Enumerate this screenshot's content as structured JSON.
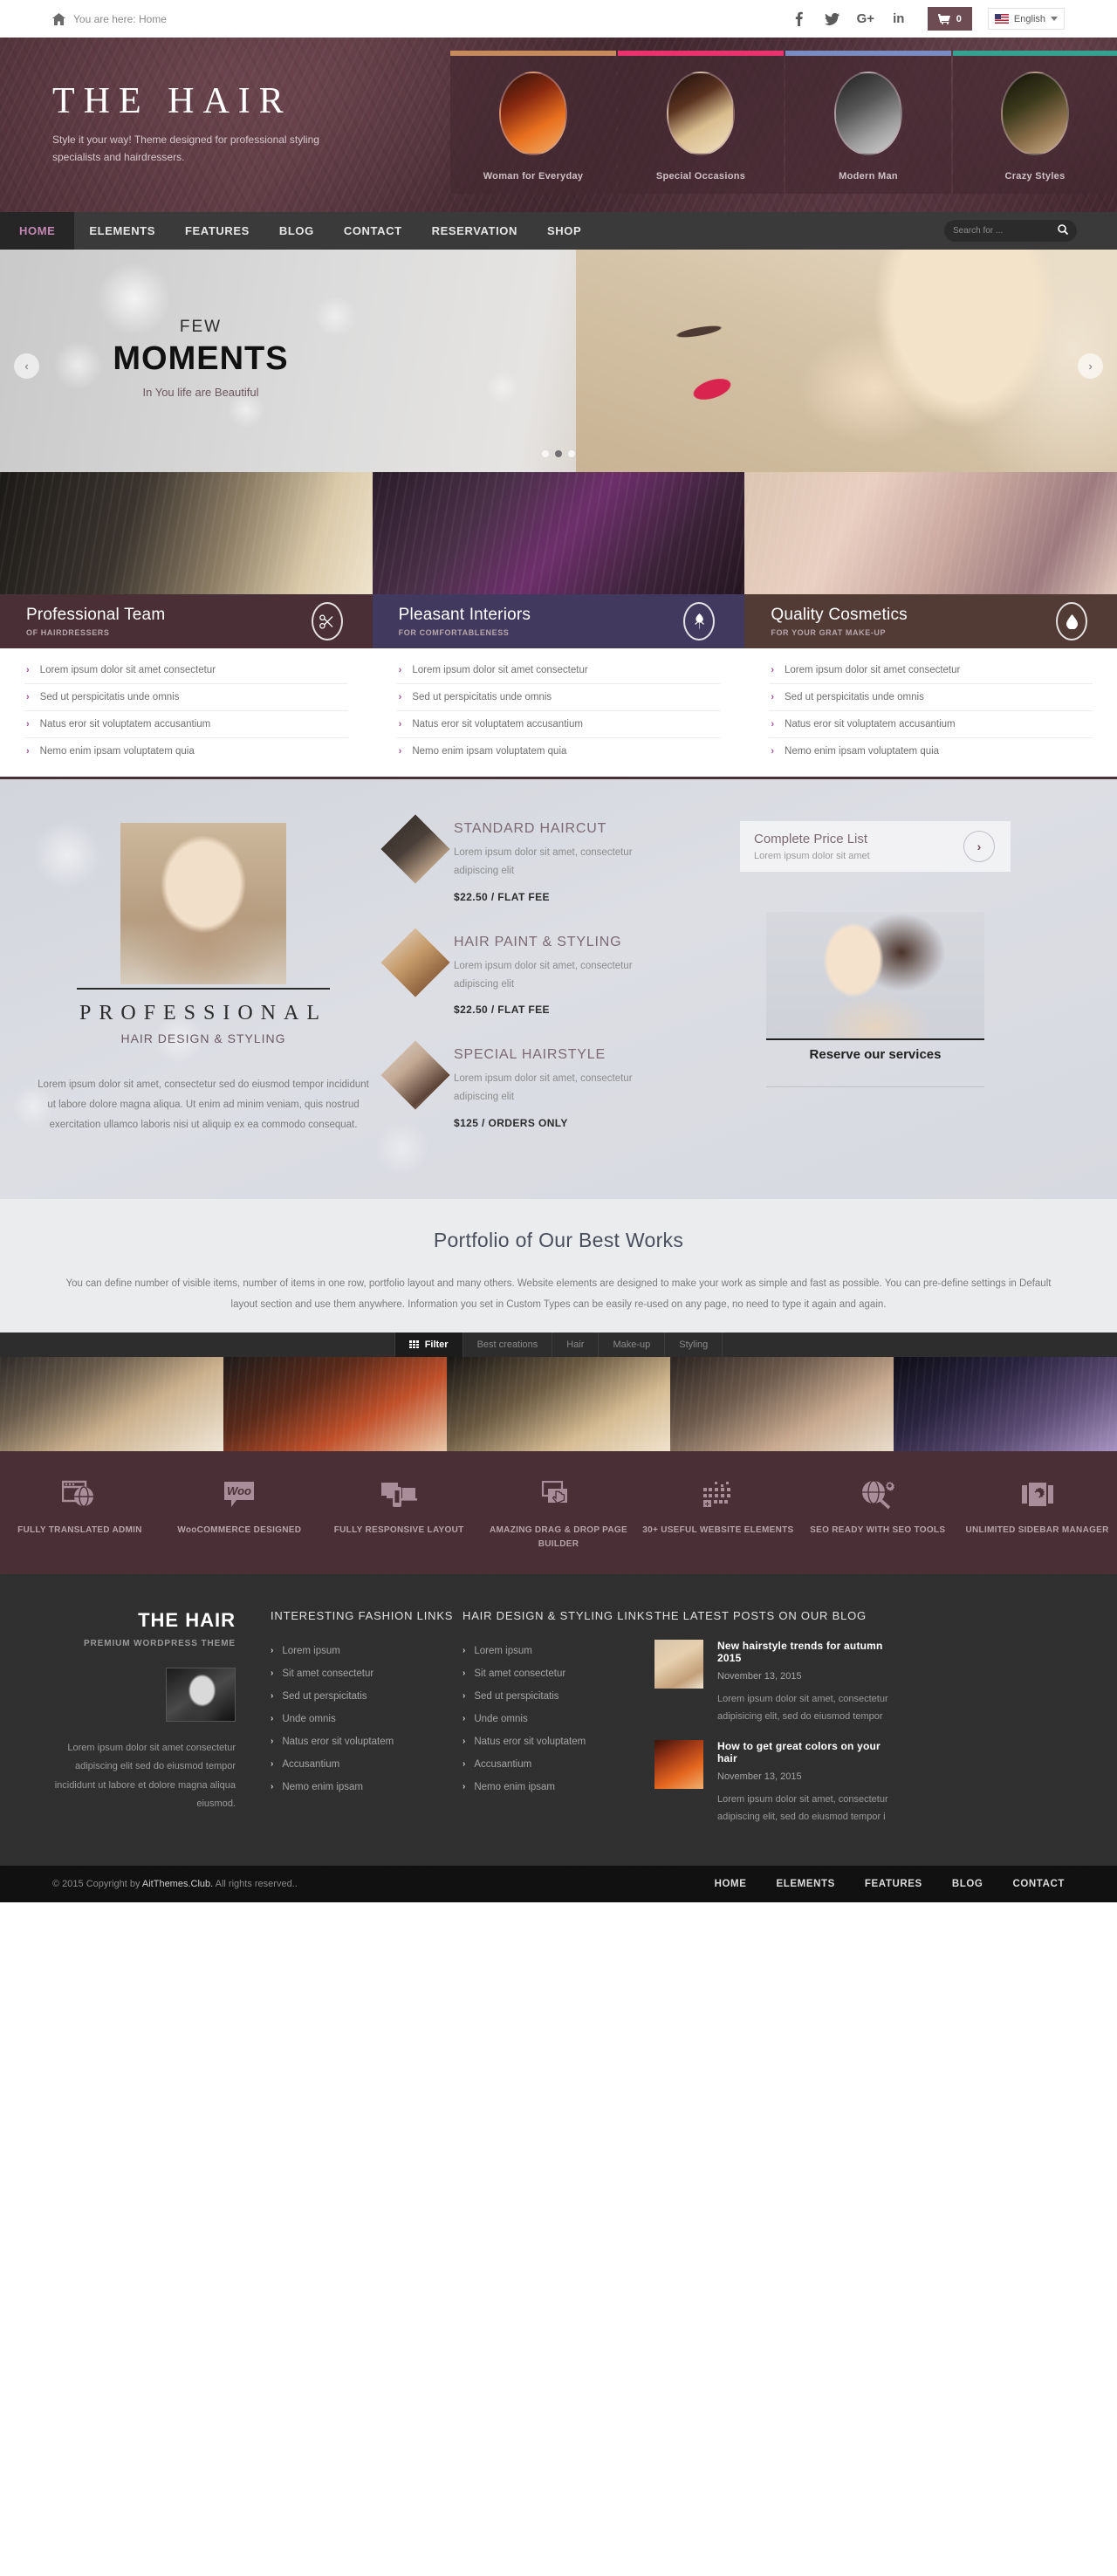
{
  "topbar": {
    "breadcrumb": "You are here: Home",
    "home_icon": "home-icon",
    "social": [
      {
        "name": "facebook-icon",
        "label": "f"
      },
      {
        "name": "twitter-icon",
        "label": "t"
      },
      {
        "name": "google-plus-icon",
        "label": "G+"
      },
      {
        "name": "linkedin-icon",
        "label": "in"
      }
    ],
    "cart_count": "0",
    "language": "English"
  },
  "header": {
    "logo": "THE HAIR",
    "tagline": "Style it your way! Theme designed for professional styling specialists and hairdressers.",
    "categories": [
      {
        "label": "Woman for Everyday",
        "accent": "#c78a5a"
      },
      {
        "label": "Special Occasions",
        "accent": "#e8336e"
      },
      {
        "label": "Modern Man",
        "accent": "#7b8dc0"
      },
      {
        "label": "Crazy Styles",
        "accent": "#37a191"
      }
    ]
  },
  "nav": {
    "items": [
      {
        "label": "HOME",
        "active": true
      },
      {
        "label": "ELEMENTS",
        "active": false
      },
      {
        "label": "FEATURES",
        "active": false
      },
      {
        "label": "BLOG",
        "active": false
      },
      {
        "label": "CONTACT",
        "active": false
      },
      {
        "label": "RESERVATION",
        "active": false
      },
      {
        "label": "SHOP",
        "active": false
      }
    ],
    "search_placeholder": "Search for ...",
    "search_value": ""
  },
  "hero": {
    "small": "FEW",
    "big": "MOMENTS",
    "tagline": "In You life are Beautiful",
    "prev": "‹",
    "next": "›",
    "active_dot": 1,
    "dots": 3
  },
  "bars": [
    {
      "title": "Professional Team",
      "sub": "OF HAIRDRESSERS",
      "icon": "scissors-icon",
      "bg": "#4b2f37"
    },
    {
      "title": "Pleasant Interiors",
      "sub": "FOR COMFORTABLENESS",
      "icon": "leaf-icon",
      "bg": "#413a5e"
    },
    {
      "title": "Quality Cosmetics",
      "sub": "FOR YOUR GRAT MAKE-UP",
      "icon": "droplet-icon",
      "bg": "#533b35"
    }
  ],
  "lists": {
    "items": [
      "Lorem ipsum dolor sit amet consectetur",
      "Sed ut perspicitatis unde omnis",
      "Natus eror sit voluptatem accusantium",
      "Nemo enim ipsam voluptatem quia"
    ]
  },
  "price_section": {
    "pro_title": "PROFESSIONAL",
    "pro_sub": "HAIR DESIGN & STYLING",
    "pro_body": "Lorem ipsum dolor sit amet, consectetur sed do eiusmod tempor incididunt ut labore dolore magna aliqua. Ut enim ad minim veniam, quis nostrud exercitation ullamco laboris nisi ut aliquip ex ea commodo consequat.",
    "services": [
      {
        "title": "STANDARD HAIRCUT",
        "desc": "Lorem ipsum dolor sit amet, consectetur adipiscing elit",
        "price": "$22.50 / FLAT FEE"
      },
      {
        "title": "HAIR PAINT & STYLING",
        "desc": "Lorem ipsum dolor sit amet, consectetur adipiscing elit",
        "price": "$22.50 / FLAT FEE"
      },
      {
        "title": "SPECIAL HAIRSTYLE",
        "desc": "Lorem ipsum dolor sit amet, consectetur adipiscing elit",
        "price": "$125 / ORDERS ONLY"
      }
    ],
    "card_title": "Complete Price List",
    "card_sub": "Lorem ipsum dolor sit amet",
    "card_arrow": "›",
    "reserve_label": "Reserve our services"
  },
  "portfolio": {
    "title": "Portfolio of Our Best Works",
    "description": "You can define number of visible items, number of items in one row, portfolio layout and many others. Website elements are designed to make your work as simple and fast as possible. You can pre-define settings in Default layout section and use them anywhere. Information you set in Custom Types can be easily re-used on any page, no need to type it again and again.",
    "filters": [
      {
        "label": "Filter",
        "active": true,
        "icon": "grid-icon"
      },
      {
        "label": "Best creations",
        "active": false
      },
      {
        "label": "Hair",
        "active": false
      },
      {
        "label": "Make-up",
        "active": false
      },
      {
        "label": "Styling",
        "active": false
      }
    ]
  },
  "features": [
    {
      "label": "FULLY TRANSLATED ADMIN",
      "icon": "translate-window-icon"
    },
    {
      "label": "WooCOMMERCE DESIGNED",
      "icon": "woocommerce-icon"
    },
    {
      "label": "FULLY RESPONSIVE LAYOUT",
      "icon": "responsive-devices-icon"
    },
    {
      "label": "AMAZING DRAG & DROP PAGE BUILDER",
      "icon": "drag-drop-icon"
    },
    {
      "label": "30+ USEFUL WEBSITE ELEMENTS",
      "icon": "elements-grid-icon"
    },
    {
      "label": "SEO READY WITH SEO TOOLS",
      "icon": "seo-magnifier-icon"
    },
    {
      "label": "UNLIMITED SIDEBAR MANAGER",
      "icon": "sidebar-gear-icon"
    }
  ],
  "footer": {
    "logo": "THE HAIR",
    "logo_sub": "PREMIUM WORDPRESS THEME",
    "about": "Lorem ipsum dolor sit amet consectetur adipiscing elit sed do eiusmod tempor incididunt ut labore et dolore magna aliqua eiusmod.",
    "col2_head": "INTERESTING FASHION LINKS",
    "col3_head": "HAIR DESIGN & STYLING LINKS",
    "links": [
      "Lorem ipsum",
      "Sit amet consectetur",
      "Sed ut perspicitatis",
      "Unde omnis",
      "Natus eror sit voluptatem",
      "Accusantium",
      "Nemo enim ipsam"
    ],
    "blog_head": "THE LATEST POSTS ON OUR BLOG",
    "posts": [
      {
        "title": "New hairstyle trends for autumn 2015",
        "date": "November 13, 2015",
        "excerpt": "Lorem ipsum dolor sit amet, consectetur adipisicing elit, sed do eiusmod tempor"
      },
      {
        "title": "How to get great colors on your hair",
        "date": "November 13, 2015",
        "excerpt": "Lorem ipsum dolor sit amet, consectetur adipiscing elit, sed do eiusmod tempor i"
      }
    ],
    "copyright_prefix": "© 2015 Copyright by ",
    "copyright_brand": "AitThemes.Club.",
    "copyright_suffix": " All rights reserved..",
    "bottom_nav": [
      "HOME",
      "ELEMENTS",
      "FEATURES",
      "BLOG",
      "CONTACT"
    ]
  }
}
